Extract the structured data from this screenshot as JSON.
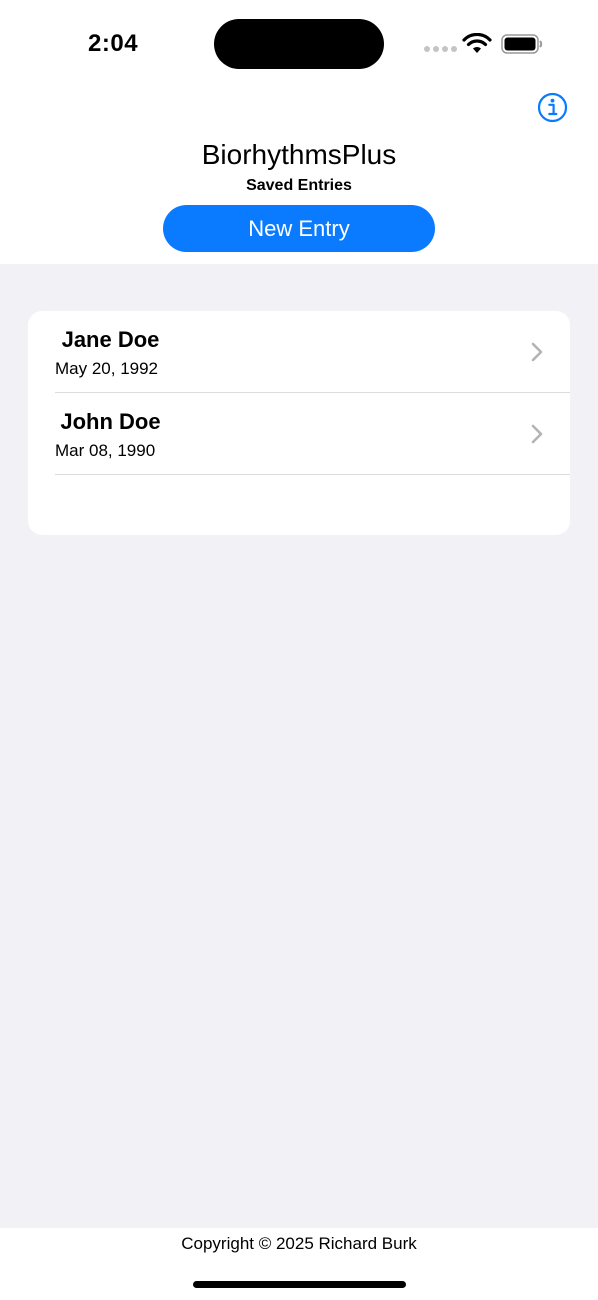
{
  "status_bar": {
    "time": "2:04"
  },
  "icons": {
    "info": "info-circle-icon",
    "wifi": "wifi-icon",
    "battery": "battery-icon",
    "chevron": "chevron-right-icon"
  },
  "colors": {
    "accent": "#0a7aff",
    "background": "#f1f1f6"
  },
  "header": {
    "title": "BiorhythmsPlus",
    "subtitle": "Saved Entries",
    "new_entry_label": "New Entry"
  },
  "entries": [
    {
      "name": "Jane Doe",
      "date": "May 20, 1992"
    },
    {
      "name": "John Doe",
      "date": "Mar 08, 1990"
    }
  ],
  "footer": {
    "copyright": "Copyright © 2025 Richard Burk"
  }
}
